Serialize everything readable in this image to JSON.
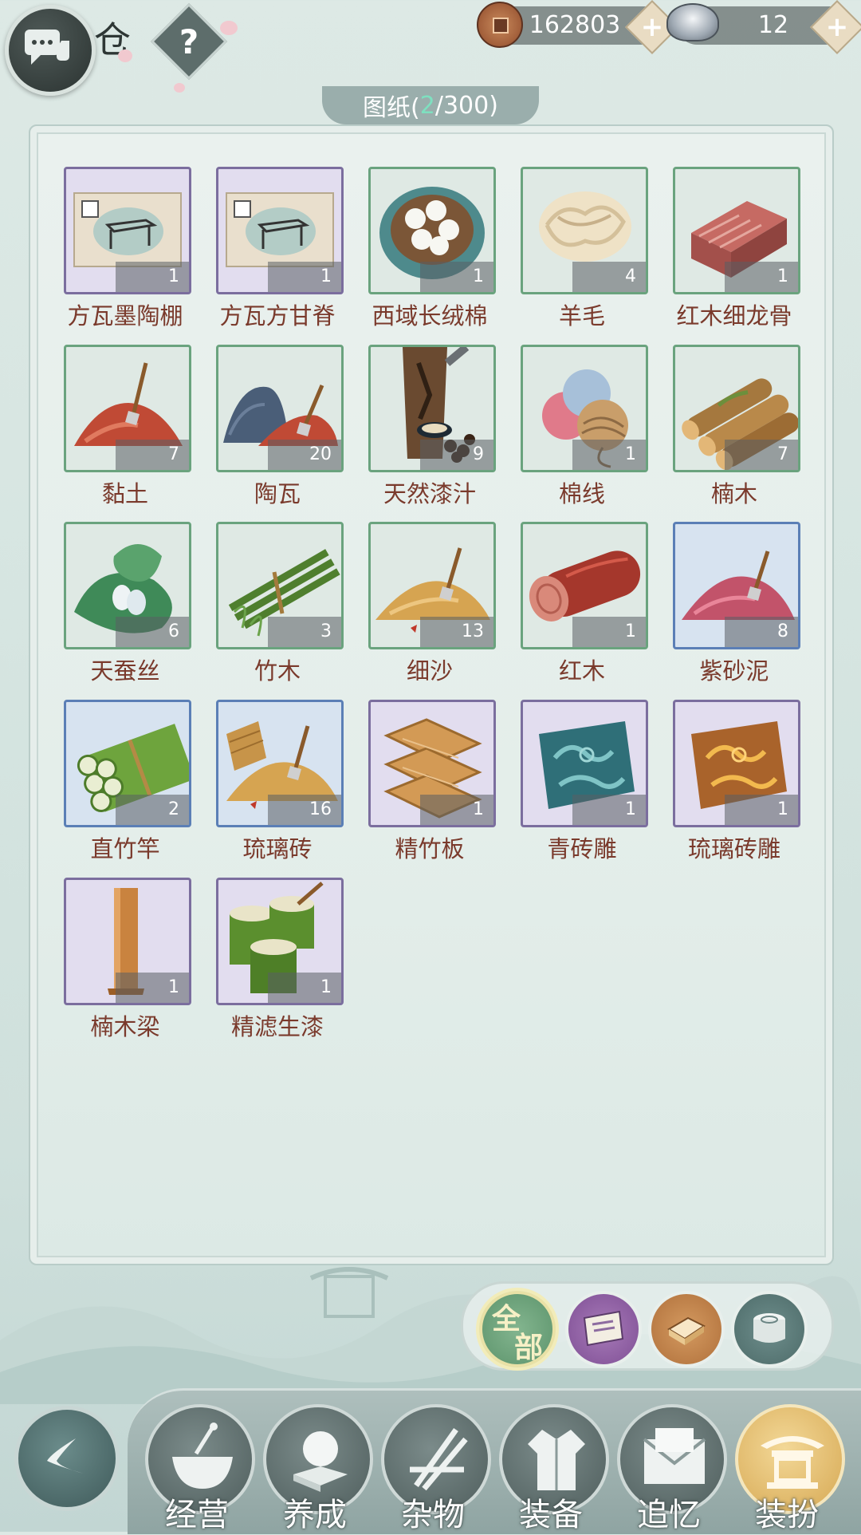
{
  "header": {
    "title_char": "仓",
    "help_label": "?",
    "copper_amount": "162803",
    "silver_amount": "12",
    "plus_label": "+"
  },
  "panel": {
    "tab_prefix": "图纸(",
    "tab_count": "2",
    "tab_suffix": "/300)"
  },
  "items": [
    {
      "name": "方瓦墨陶棚",
      "count": "1",
      "rarity": "purple",
      "icon": "blueprint-icon"
    },
    {
      "name": "方瓦方甘脊",
      "count": "1",
      "rarity": "purple",
      "icon": "blueprint-icon"
    },
    {
      "name": "西域长绒棉",
      "count": "1",
      "rarity": "green",
      "icon": "cotton-basket-icon"
    },
    {
      "name": "羊毛",
      "count": "4",
      "rarity": "green",
      "icon": "wool-icon"
    },
    {
      "name": "红木细龙骨",
      "count": "1",
      "rarity": "green",
      "icon": "brick-stack-icon"
    },
    {
      "name": "黏土",
      "count": "7",
      "rarity": "green",
      "icon": "clay-pile-icon"
    },
    {
      "name": "陶瓦",
      "count": "20",
      "rarity": "green",
      "icon": "tile-pile-icon"
    },
    {
      "name": "天然漆汁",
      "count": "9",
      "rarity": "green",
      "icon": "lacquer-tree-icon"
    },
    {
      "name": "棉线",
      "count": "1",
      "rarity": "green",
      "icon": "yarn-icon"
    },
    {
      "name": "楠木",
      "count": "7",
      "rarity": "green",
      "icon": "log-bundle-icon"
    },
    {
      "name": "天蚕丝",
      "count": "6",
      "rarity": "green",
      "icon": "silk-cocoon-icon"
    },
    {
      "name": "竹木",
      "count": "3",
      "rarity": "green",
      "icon": "bamboo-bundle-icon"
    },
    {
      "name": "细沙",
      "count": "13",
      "rarity": "green",
      "icon": "sand-pile-icon"
    },
    {
      "name": "红木",
      "count": "1",
      "rarity": "green",
      "icon": "redwood-log-icon"
    },
    {
      "name": "紫砂泥",
      "count": "8",
      "rarity": "blue",
      "icon": "purple-clay-icon"
    },
    {
      "name": "直竹竿",
      "count": "2",
      "rarity": "blue",
      "icon": "bamboo-poles-icon"
    },
    {
      "name": "琉璃砖",
      "count": "16",
      "rarity": "blue",
      "icon": "glazed-brick-icon"
    },
    {
      "name": "精竹板",
      "count": "1",
      "rarity": "purple",
      "icon": "bamboo-board-icon"
    },
    {
      "name": "青砖雕",
      "count": "1",
      "rarity": "purple",
      "icon": "blue-carving-icon"
    },
    {
      "name": "琉璃砖雕",
      "count": "1",
      "rarity": "purple",
      "icon": "gold-carving-icon"
    },
    {
      "name": "楠木梁",
      "count": "1",
      "rarity": "purple",
      "icon": "wood-beam-icon"
    },
    {
      "name": "精滤生漆",
      "count": "1",
      "rarity": "purple",
      "icon": "lacquer-bucket-icon"
    }
  ],
  "filters": {
    "all_label_top": "全",
    "all_label_bottom": "部"
  },
  "nav": [
    {
      "label": "经营",
      "icon": "bowl-icon"
    },
    {
      "label": "养成",
      "icon": "pearl-icon"
    },
    {
      "label": "杂物",
      "icon": "sticks-icon"
    },
    {
      "label": "装备",
      "icon": "robe-icon"
    },
    {
      "label": "追忆",
      "icon": "letter-icon"
    },
    {
      "label": "装扮",
      "icon": "pavilion-icon"
    }
  ],
  "colors": {
    "label_text": "#7a3a2c",
    "green_border": "#6aa37e",
    "blue_border": "#5b7fb6",
    "purple_border": "#7b6e9e",
    "active_nav": "#d6a853"
  }
}
